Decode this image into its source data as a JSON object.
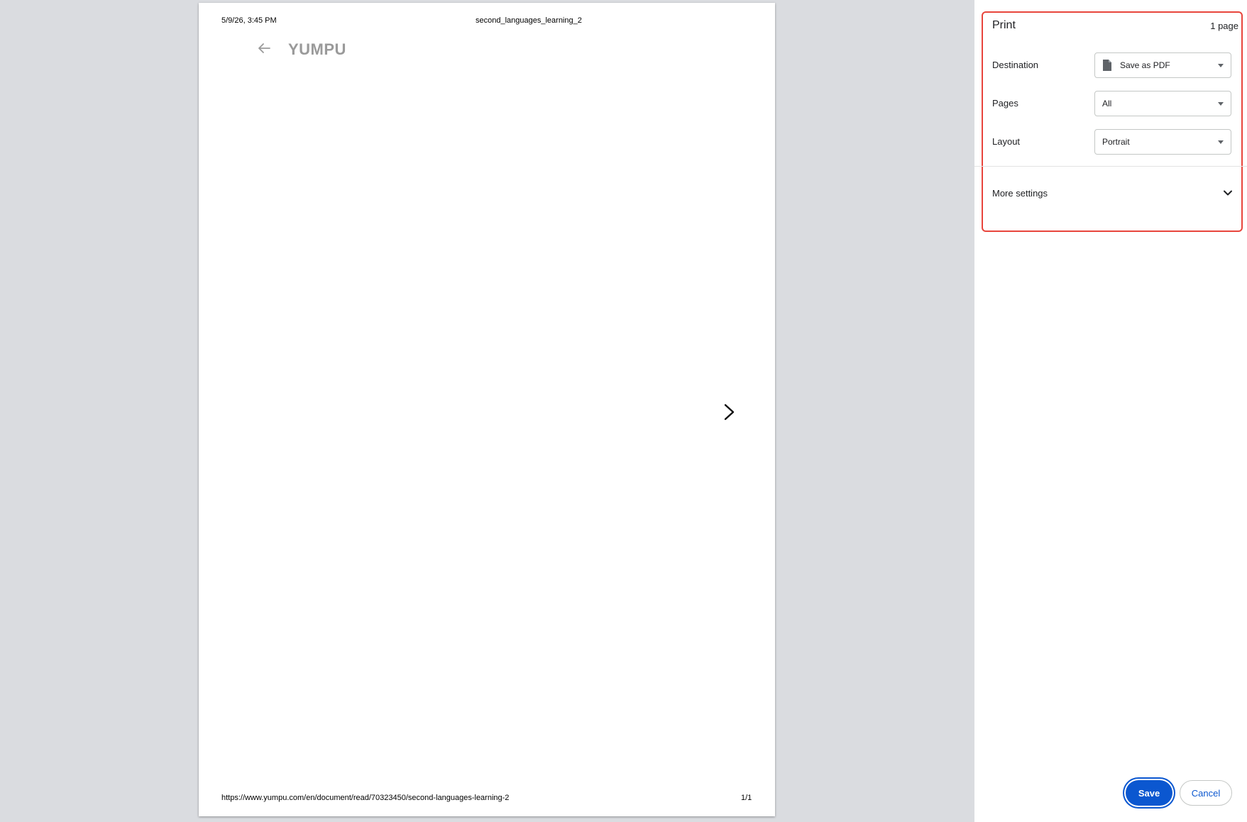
{
  "preview": {
    "header_date": "5/9/26, 3:45 PM",
    "header_title": "second_languages_learning_2",
    "logo_text": "YUMPU",
    "footer_url": "https://www.yumpu.com/en/document/read/70323450/second-languages-learning-2",
    "footer_page": "1/1",
    "icons": {
      "back": "arrow-left-icon",
      "next": "chevron-right-icon"
    }
  },
  "settings": {
    "title": "Print",
    "page_count": "1 page",
    "destination": {
      "label": "Destination",
      "value": "Save as PDF",
      "icon": "file-icon"
    },
    "pages": {
      "label": "Pages",
      "value": "All"
    },
    "layout": {
      "label": "Layout",
      "value": "Portrait"
    },
    "more_settings": "More settings",
    "save_label": "Save",
    "cancel_label": "Cancel"
  },
  "colors": {
    "accent": "#0b57d0",
    "highlight_outline": "#e8453c",
    "background": "#dadce0",
    "logo": "#9a9a9a"
  }
}
